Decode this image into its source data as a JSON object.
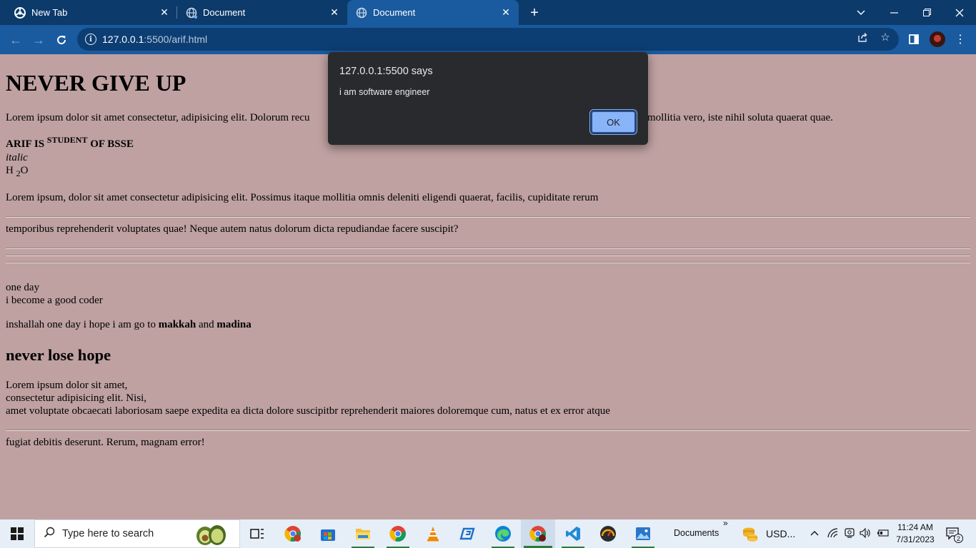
{
  "browser": {
    "tabs": [
      {
        "title": "New Tab"
      },
      {
        "title": "Document"
      },
      {
        "title": "Document"
      }
    ],
    "url_host": "127.0.0.1",
    "url_path": ":5500/arif.html"
  },
  "page": {
    "heading": "NEVER GIVE UP",
    "p1": "Lorem ipsum dolor sit amet consectetur, adipisicing elit. Dolorum recu",
    "p1_tail": "mollitia vero, iste nihil soluta quaerat quae.",
    "bold_pre": "ARIF IS ",
    "bold_sup": "STUDENT",
    "bold_post": " OF BSSE",
    "italic": "italic",
    "h2o_pre": "H ",
    "h2o_sub": "2",
    "h2o_post": "O",
    "p2": "Lorem ipsum, dolor sit amet consectetur adipisicing elit. Possimus itaque mollitia omnis deleniti eligendi quaerat, facilis, cupiditate rerum",
    "p3": "temporibus reprehenderit voluptates quae! Neque autem natus dolorum dicta repudiandae facere suscipit?",
    "line_one_day": "one day",
    "line_coder": "i become a good coder",
    "inshallah_pre": "inshallah one day i hope i am go to ",
    "makkah": "makkah",
    "and": " and ",
    "madina": "madina",
    "subheading": "never lose hope",
    "para_l1": "Lorem ipsum dolor sit amet,",
    "para_l2": "consectetur adipisicing elit. Nisi,",
    "para_l3": "amet voluptate obcaecati laboriosam saepe expedita ea dicta dolore suscipitbr reprehenderit maiores doloremque cum, natus et ex error atque",
    "last_line": "fugiat debitis deserunt. Rerum, magnam error!"
  },
  "alert": {
    "origin": "127.0.0.1:5500 says",
    "message": "i am software engineer",
    "ok_label": "OK"
  },
  "taskbar": {
    "search_placeholder": "Type here to search",
    "documents_label": "Documents",
    "chevron": "»",
    "weather_label": "USD...",
    "time": "11:24 AM",
    "date": "7/31/2023",
    "notification_count": "2"
  },
  "colors": {
    "page_background": "#bfa1a1",
    "tabstrip": "#0c3a6b",
    "toolbar": "#1a5a9e",
    "dialog": "#292a2d",
    "ok_button": "#8ab4f8"
  }
}
